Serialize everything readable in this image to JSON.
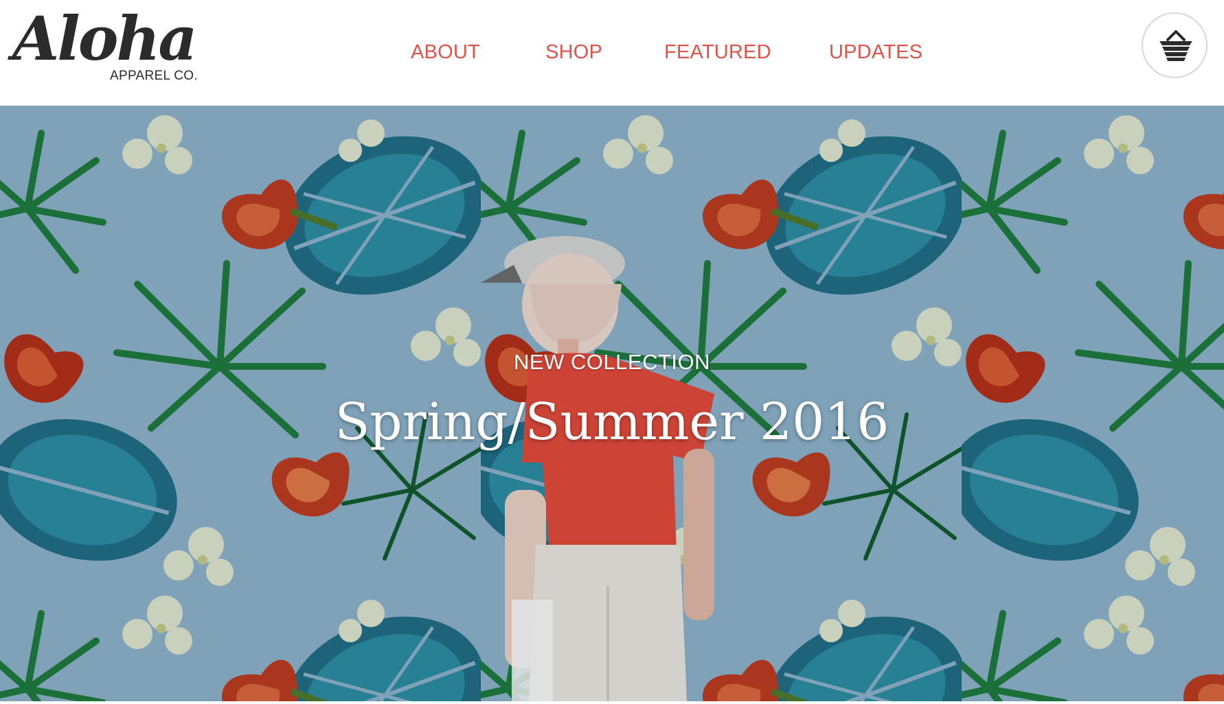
{
  "brand": {
    "logo_script": "Aloha",
    "logo_sub": "APPAREL CO."
  },
  "nav": {
    "items": [
      {
        "label": "ABOUT"
      },
      {
        "label": "SHOP"
      },
      {
        "label": "FEATURED"
      },
      {
        "label": "UPDATES"
      }
    ]
  },
  "cart": {
    "icon": "basket-icon"
  },
  "hero": {
    "kicker": "NEW COLLECTION",
    "title": "Spring/Summer 2016",
    "background": "tropical-leaf-pattern-image"
  },
  "colors": {
    "accent": "#e0534a",
    "logo": "#2b2b2b",
    "hero_bg": "#8fb4cc"
  }
}
